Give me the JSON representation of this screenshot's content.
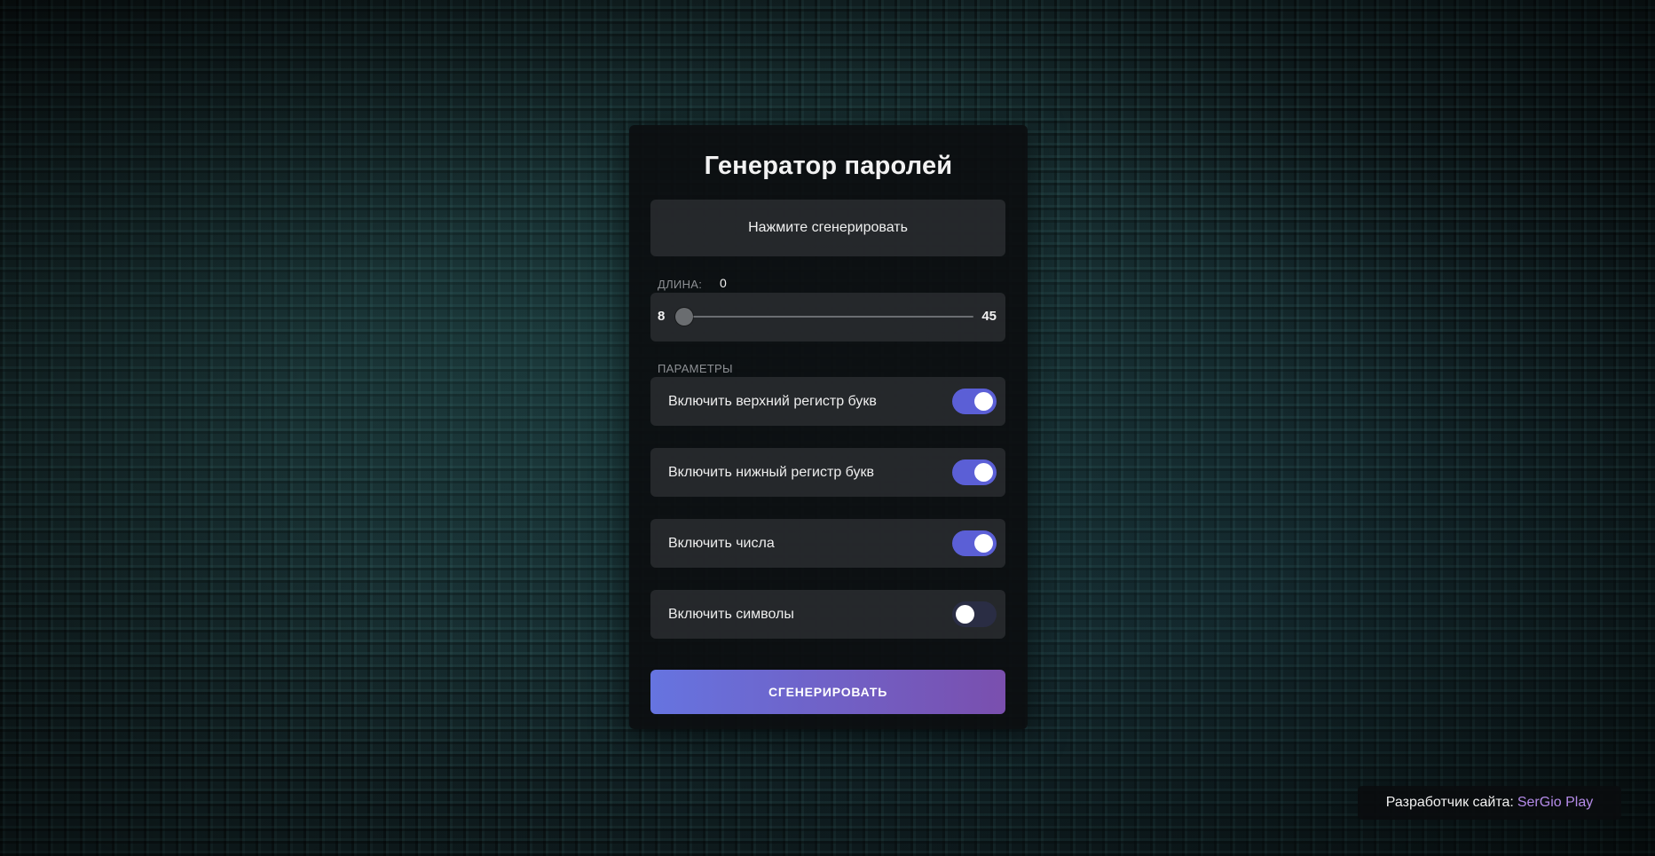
{
  "app": {
    "title": "Генератор паролей"
  },
  "output": {
    "placeholder_text": "Нажмите сгенерировать"
  },
  "length": {
    "label": "ДЛИНА:",
    "value": "0",
    "min_label": "8",
    "max_label": "45",
    "min": 8,
    "max": 45,
    "thumb_fraction": 0
  },
  "params": {
    "label": "ПАРАМЕТРЫ",
    "options": [
      {
        "label": "Включить верхний регистр букв",
        "enabled": true
      },
      {
        "label": "Включить нижный регистр букв",
        "enabled": true
      },
      {
        "label": "Включить числа",
        "enabled": true
      },
      {
        "label": "Включить символы",
        "enabled": false
      }
    ]
  },
  "generate_button": {
    "label": "СГЕНЕРИРОВАТЬ"
  },
  "credit": {
    "prefix": "Разработчик сайта:",
    "author": "SerGio Play"
  },
  "colors": {
    "accent": "#5b5fd6",
    "button_gradient_start": "#6674e0",
    "button_gradient_end": "#7a4fae",
    "credit_link": "#b48be8"
  }
}
